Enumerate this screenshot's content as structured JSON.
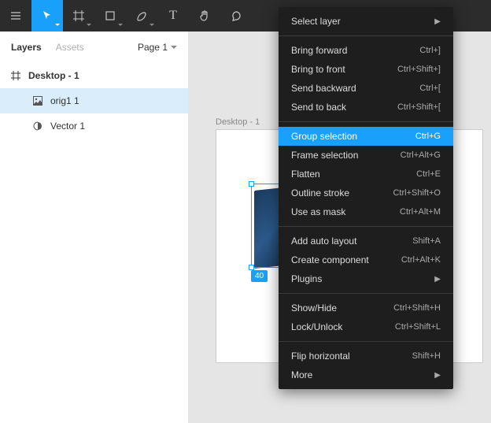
{
  "toolbar": {
    "tools": [
      {
        "name": "menu"
      },
      {
        "name": "move",
        "active": true,
        "has_caret": true
      },
      {
        "name": "frame",
        "has_caret": true
      },
      {
        "name": "shape",
        "has_caret": true
      },
      {
        "name": "pen",
        "has_caret": true
      },
      {
        "name": "text"
      },
      {
        "name": "hand"
      },
      {
        "name": "comment"
      }
    ]
  },
  "sidebar": {
    "tabs": {
      "layers": "Layers",
      "assets": "Assets"
    },
    "page_label": "Page 1",
    "layers": [
      {
        "type": "frame",
        "label": "Desktop - 1"
      },
      {
        "type": "image",
        "label": "orig1 1",
        "selected": true
      },
      {
        "type": "vector",
        "label": "Vector 1"
      }
    ]
  },
  "canvas": {
    "frame_label": "Desktop - 1",
    "size_badge": "40"
  },
  "context_menu": {
    "groups": [
      [
        {
          "label": "Select layer",
          "submenu": true
        }
      ],
      [
        {
          "label": "Bring forward",
          "shortcut": "Ctrl+]"
        },
        {
          "label": "Bring to front",
          "shortcut": "Ctrl+Shift+]"
        },
        {
          "label": "Send backward",
          "shortcut": "Ctrl+["
        },
        {
          "label": "Send to back",
          "shortcut": "Ctrl+Shift+["
        }
      ],
      [
        {
          "label": "Group selection",
          "shortcut": "Ctrl+G",
          "highlight": true
        },
        {
          "label": "Frame selection",
          "shortcut": "Ctrl+Alt+G"
        },
        {
          "label": "Flatten",
          "shortcut": "Ctrl+E"
        },
        {
          "label": "Outline stroke",
          "shortcut": "Ctrl+Shift+O"
        },
        {
          "label": "Use as mask",
          "shortcut": "Ctrl+Alt+M"
        }
      ],
      [
        {
          "label": "Add auto layout",
          "shortcut": "Shift+A"
        },
        {
          "label": "Create component",
          "shortcut": "Ctrl+Alt+K"
        },
        {
          "label": "Plugins",
          "submenu": true
        }
      ],
      [
        {
          "label": "Show/Hide",
          "shortcut": "Ctrl+Shift+H"
        },
        {
          "label": "Lock/Unlock",
          "shortcut": "Ctrl+Shift+L"
        }
      ],
      [
        {
          "label": "Flip horizontal",
          "shortcut": "Shift+H"
        },
        {
          "label": "More",
          "submenu": true
        }
      ]
    ]
  }
}
